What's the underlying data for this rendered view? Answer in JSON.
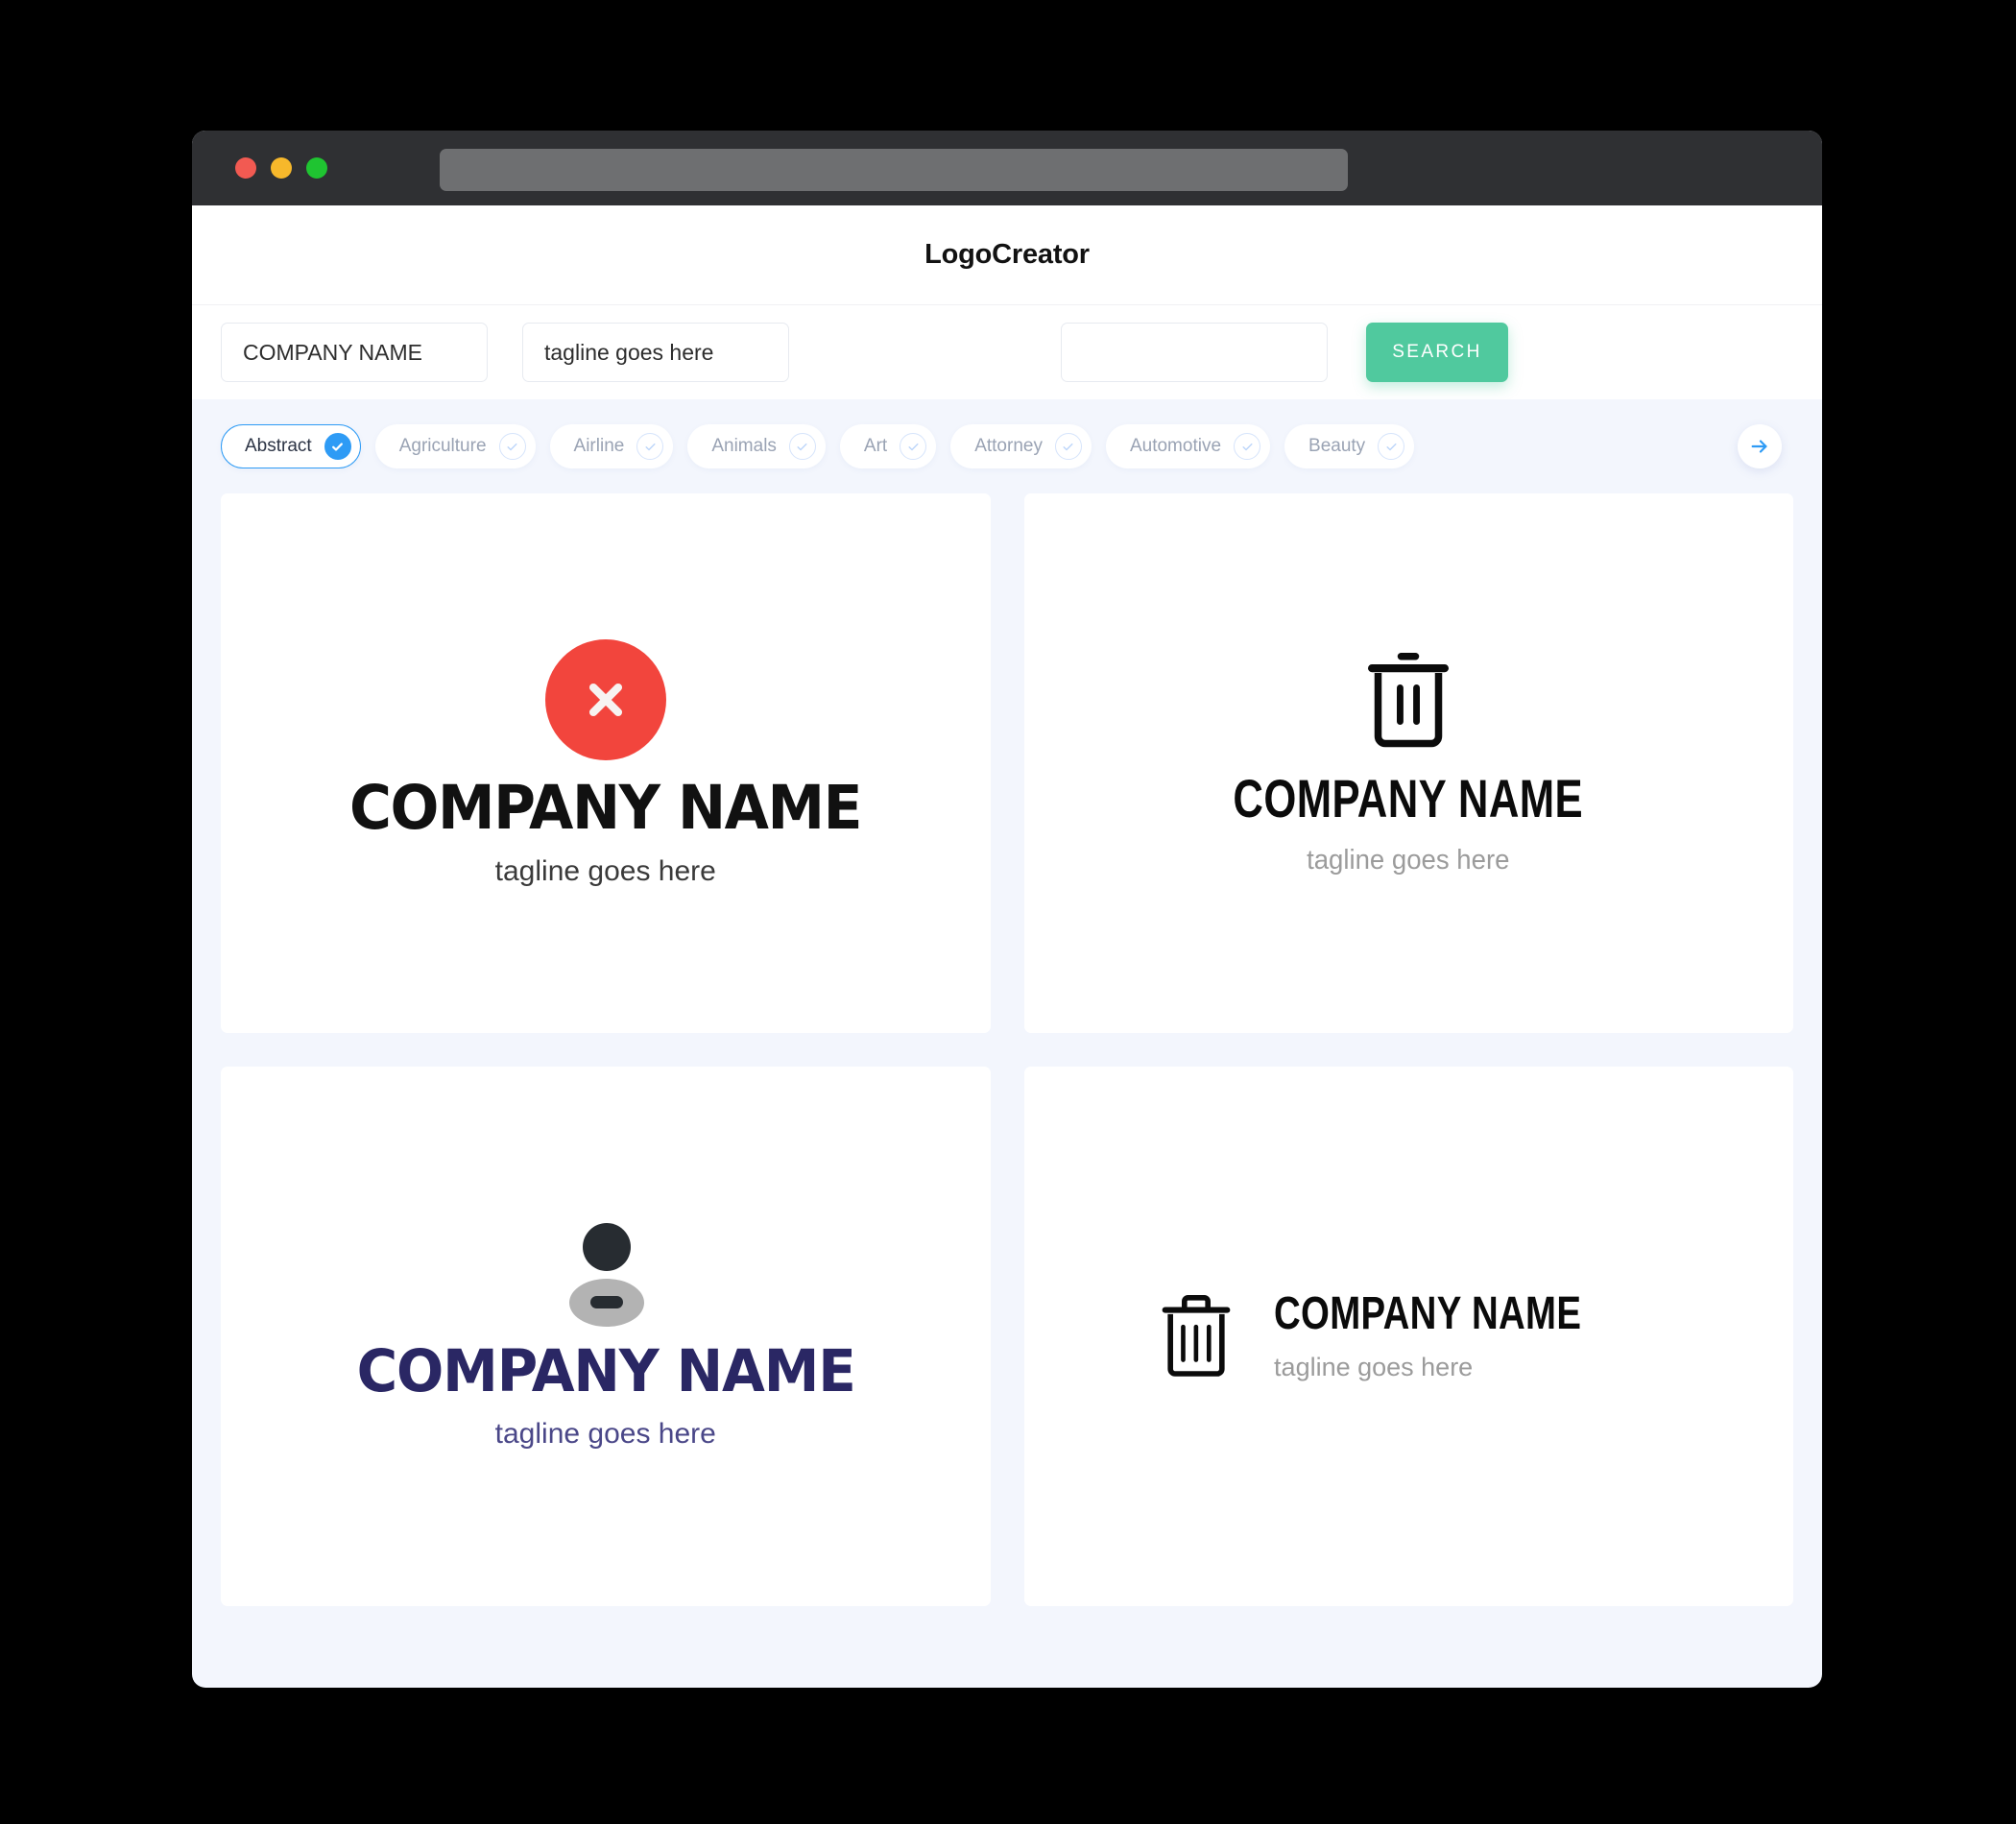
{
  "browser": {
    "traffic_lights": [
      "close",
      "minimize",
      "maximize"
    ],
    "url_value": ""
  },
  "header": {
    "app_title": "LogoCreator"
  },
  "search": {
    "company_value": "COMPANY NAME",
    "company_placeholder": "COMPANY NAME",
    "tagline_value": "tagline goes here",
    "tagline_placeholder": "tagline goes here",
    "extra_value": "",
    "extra_placeholder": "",
    "search_label": "SEARCH",
    "search_button_color": "#50c99e"
  },
  "categories": {
    "next_arrow_icon": "arrow-right-icon",
    "accent_color": "#2e9bf5",
    "items": [
      {
        "label": "Abstract",
        "selected": true
      },
      {
        "label": "Agriculture",
        "selected": false
      },
      {
        "label": "Airline",
        "selected": false
      },
      {
        "label": "Animals",
        "selected": false
      },
      {
        "label": "Art",
        "selected": false
      },
      {
        "label": "Attorney",
        "selected": false
      },
      {
        "label": "Automotive",
        "selected": false
      },
      {
        "label": "Beauty",
        "selected": false
      }
    ]
  },
  "results": {
    "cards": [
      {
        "icon": "circle-x-icon",
        "icon_color": "#f2453d",
        "name": "COMPANY NAME",
        "tagline": "tagline goes here",
        "name_color": "#111111",
        "tagline_color": "#3a3a3a",
        "layout": "stacked"
      },
      {
        "icon": "trash-can-icon",
        "icon_color": "#0b0b0b",
        "name": "COMPANY NAME",
        "tagline": "tagline goes here",
        "name_color": "#0b0b0b",
        "tagline_color": "#9b9b9b",
        "layout": "stacked"
      },
      {
        "icon": "person-avatar-icon",
        "icon_color": "#272c31",
        "name": "COMPANY NAME",
        "tagline": "tagline goes here",
        "name_color": "#2a2764",
        "tagline_color": "#4a4788",
        "layout": "stacked"
      },
      {
        "icon": "trash-can-icon",
        "icon_color": "#0b0b0b",
        "name": "COMPANY NAME",
        "tagline": "tagline goes here",
        "name_color": "#0b0b0b",
        "tagline_color": "#9b9b9b",
        "layout": "horizontal"
      }
    ]
  }
}
